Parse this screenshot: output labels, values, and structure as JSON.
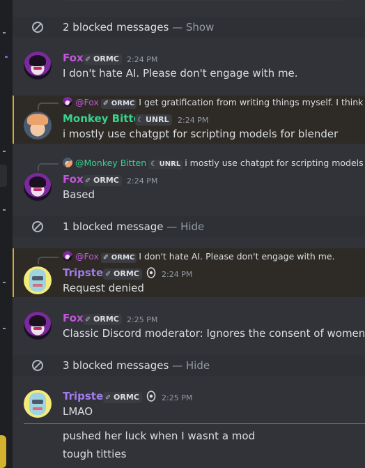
{
  "blocked": [
    {
      "text": "2 blocked messages",
      "sep": " — ",
      "action": "Show"
    },
    {
      "text": "1 blocked message",
      "sep": " — ",
      "action": "Hide"
    },
    {
      "text": "3 blocked messages",
      "sep": " — ",
      "action": "Hide"
    }
  ],
  "messages": [
    {
      "user": "Fox",
      "tag": "ORMC",
      "time": "2:24 PM",
      "text": "I don't hate AI. Please don't engage with me."
    },
    {
      "reply_user": "@Fox",
      "reply_tag": "ORMC",
      "reply_text": "I get gratification from writing things myself. I think it",
      "user": "Monkey Bitten",
      "tag": "UNRL",
      "time": "2:24 PM",
      "text": "i mostly use chatgpt for scripting models for blender"
    },
    {
      "reply_user": "@Monkey Bitten",
      "reply_tag": "UNRL",
      "reply_text": "i mostly use chatgpt for scripting models fo",
      "user": "Fox",
      "tag": "ORMC",
      "time": "2:24 PM",
      "text": "Based"
    },
    {
      "reply_user": "@Fox",
      "reply_tag": "ORMC",
      "reply_text": "I don't hate AI. Please don't engage with me.",
      "user": "Tripster",
      "tag": "ORMC",
      "time": "2:24 PM",
      "text": "Request denied"
    },
    {
      "user": "Fox",
      "tag": "ORMC",
      "time": "2:25 PM",
      "text": "Classic Discord moderator: Ignores the consent of women."
    },
    {
      "user": "Tripster",
      "tag": "ORMC",
      "time": "2:25 PM",
      "text": "LMAO"
    }
  ],
  "followups": [
    "pushed her luck when I wasnt a mod",
    "tough titties"
  ],
  "colors": {
    "fox": "#c157d8",
    "monkey": "#35d38e",
    "tripster": "#a07bea",
    "new_divider": "#f23f43",
    "mention_border": "#d4a93d"
  },
  "icons": {
    "blocked": "block-icon",
    "tag": "pen-nib-icon",
    "tag_unrl": "moon-icon",
    "role": "shield-face-icon"
  }
}
